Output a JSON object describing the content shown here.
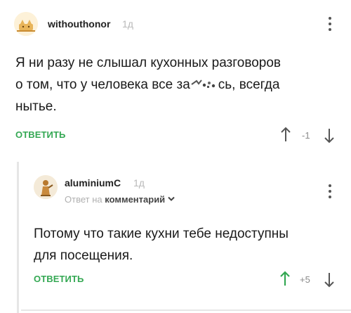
{
  "comment": {
    "username": "withouthonor",
    "time": "1д",
    "text_line1": "Я ни разу не слышал кухонных разговоров",
    "text_line2_part1": "о том, что у человека все за",
    "text_line2_part2": "сь, всегда",
    "text_line3": "нытье.",
    "reply_label": "ОТВЕТИТЬ",
    "rating": "-1"
  },
  "reply": {
    "username": "aluminiumC",
    "time": "1д",
    "reply_to_prefix": "Ответ на",
    "reply_to_target": "комментарий",
    "text_line1": "Потому что такие кухни тебе недоступны",
    "text_line2": "для посещения.",
    "reply_label": "ОТВЕТИТЬ",
    "rating": "+5"
  },
  "colors": {
    "accent_green": "#34a853",
    "muted_gray": "#8a8a8a",
    "thread_line": "#e6e6e6"
  },
  "icons": [
    "avatar-cat-icon",
    "avatar-figure-icon",
    "more-dots-icon",
    "arrow-up-icon",
    "arrow-down-icon",
    "chevron-down-icon",
    "censor-blot-icon"
  ]
}
